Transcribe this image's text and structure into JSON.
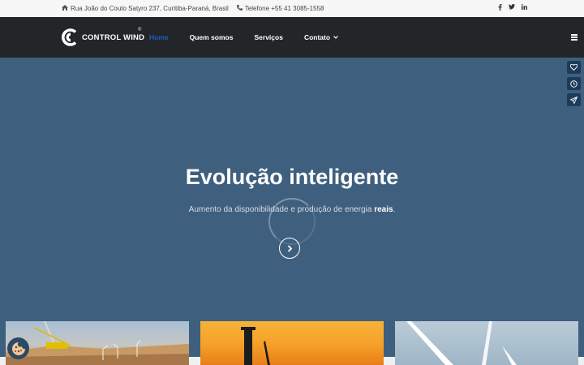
{
  "topbar": {
    "address_icon": "home-icon",
    "address": "Rua João do Couto Satyro 237, Curitiba-Paraná, Brasil",
    "phone_icon": "phone-icon",
    "phone": "Telefone +55 41 3085-1558",
    "social": [
      "facebook-icon",
      "twitter-icon",
      "linkedin-icon"
    ]
  },
  "nav": {
    "logo_text": "CONTROL WIND",
    "logo_reg": "®",
    "items": [
      {
        "label": "Home"
      },
      {
        "label": "Quem somos"
      },
      {
        "label": "Serviços"
      },
      {
        "label": "Contato"
      }
    ],
    "active_color": "#1f5fbf"
  },
  "side_buttons": [
    "heart-icon",
    "clock-icon",
    "send-icon"
  ],
  "hero": {
    "title": "Evolução inteligente",
    "subtitle_prefix": "Aumento da disponibilidade e produção de energia ",
    "subtitle_bold": "reais",
    "subtitle_suffix": ".",
    "background": "#3f5f7e"
  },
  "cards": [
    {
      "name": "wind-farm-construction-image"
    },
    {
      "name": "turbine-sunset-image"
    },
    {
      "name": "turbine-blades-image"
    }
  ],
  "cookie_icon": "cookie-icon"
}
